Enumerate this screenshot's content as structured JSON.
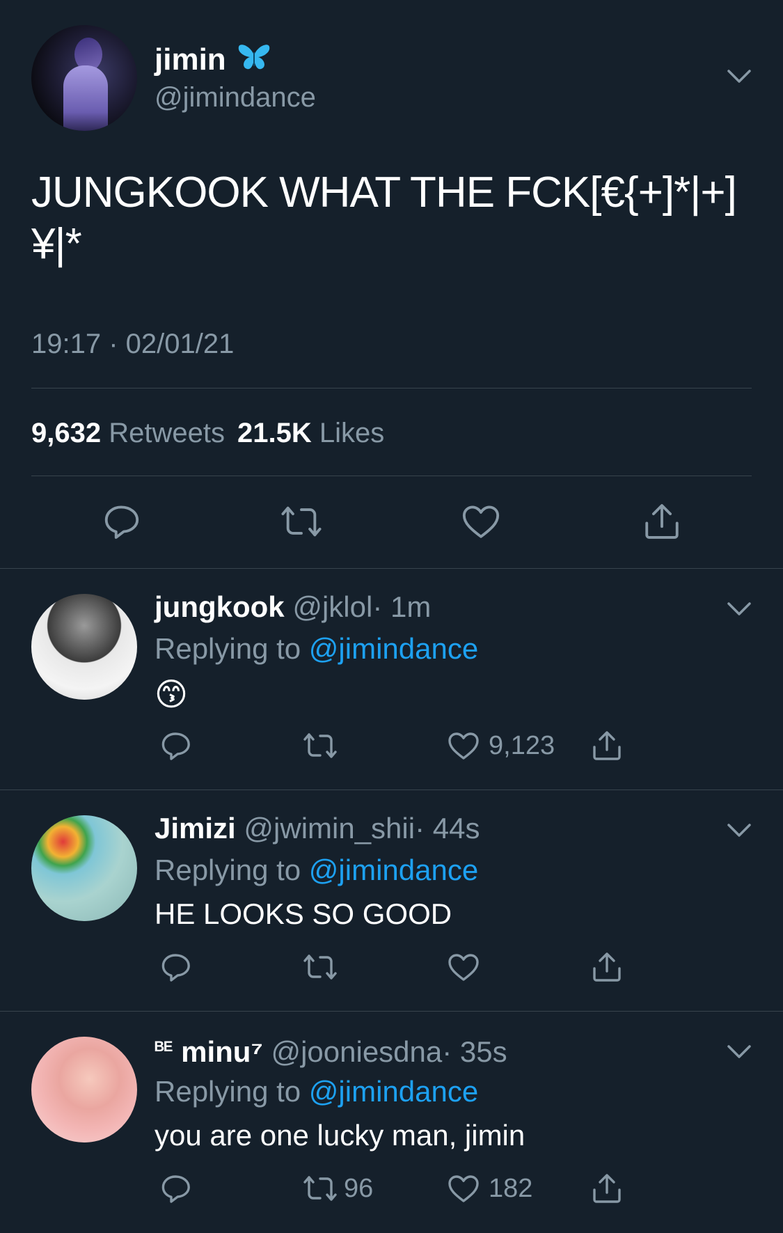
{
  "main_tweet": {
    "name": "jimin",
    "handle": "@jimindance",
    "text": "JUNGKOOK WHAT THE FCK[€{+]*|+] ¥|*",
    "timestamp": "19:17 · 02/01/21",
    "retweets_count": "9,632",
    "retweets_label": "Retweets",
    "likes_count": "21.5K",
    "likes_label": "Likes",
    "emoji_name": "blue-butterfly-icon"
  },
  "replies": [
    {
      "name": "jungkook",
      "handle": "@jklol",
      "time": "· 1m",
      "replying_prefix": "Replying to",
      "replying_handle": "@jimindance",
      "text": "😙",
      "like_count": "9,123",
      "retweet_count": ""
    },
    {
      "name": "Jimizi",
      "handle": "@jwimin_shii",
      "time": "· 44s",
      "replying_prefix": "Replying to",
      "replying_handle": "@jimindance",
      "text": "HE LOOKS SO GOOD",
      "like_count": "",
      "retweet_count": ""
    },
    {
      "name_prefix": "ᴮᴱ",
      "name": "minu⁷",
      "handle": "@jooniesdna",
      "time": "· 35s",
      "replying_prefix": "Replying to",
      "replying_handle": "@jimindance",
      "text": "you are one lucky man, jimin",
      "like_count": "182",
      "retweet_count": "96"
    }
  ],
  "colors": {
    "background": "#15202b",
    "muted": "#8899a6",
    "link": "#1da1f2",
    "divider": "#38444d"
  }
}
